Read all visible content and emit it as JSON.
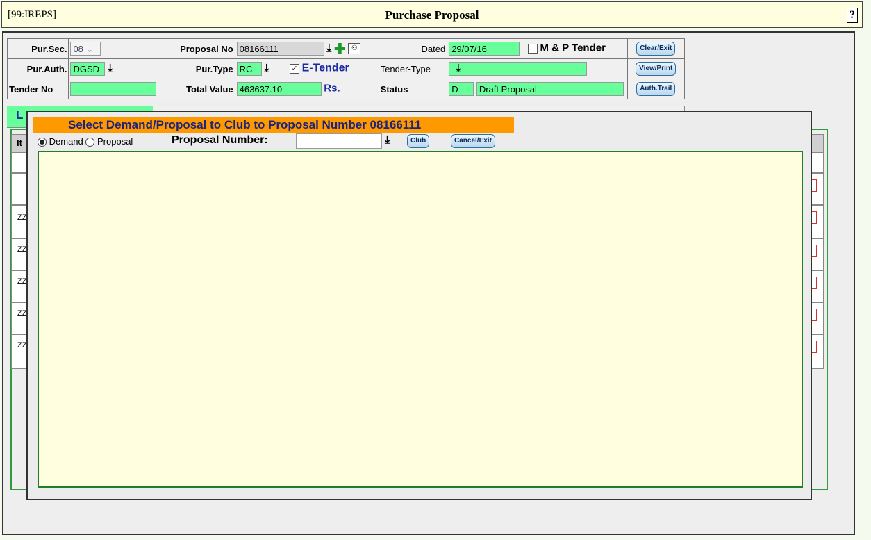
{
  "title_bar": {
    "system_id": "[99:IREPS]",
    "title": "Purchase Proposal",
    "help": "?"
  },
  "header": {
    "pur_sec": {
      "label": "Pur.Sec.",
      "value": "08"
    },
    "proposal_no": {
      "label": "Proposal No",
      "value": "08166111"
    },
    "dated": {
      "label": "Dated",
      "value": "29/07/16"
    },
    "mp_tender": {
      "label": "M & P Tender",
      "checked": false
    },
    "clear_exit": "Clear/Exit",
    "pur_auth": {
      "label": "Pur.Auth.",
      "value": "DGSD"
    },
    "pur_type": {
      "label": "Pur.Type",
      "value": "RC"
    },
    "e_tender": {
      "label": "E-Tender",
      "checked": true
    },
    "tender_type": {
      "label": "Tender-Type",
      "value": ""
    },
    "view_print": "View/Print",
    "tender_no": {
      "label": "Tender No",
      "value": ""
    },
    "total_value": {
      "label": "Total Value",
      "value": "463637.10",
      "unit": "Rs."
    },
    "status": {
      "label": "Status",
      "code": "D",
      "text": "Draft Proposal"
    },
    "auth_trail": "Auth.Trail"
  },
  "background_rows": {
    "partial_label_top": "L",
    "partial_label_col": "It",
    "row_codes": [
      "ZZ",
      "ZZ",
      "ZZ",
      "ZZ",
      "ZZ"
    ]
  },
  "modal": {
    "title": "Select Demand/Proposal to Club to Proposal Number 08166111",
    "radio_demand": "Demand",
    "radio_proposal": "Proposal",
    "selected": "Demand",
    "proposal_number_label": "Proposal Number:",
    "proposal_number_value": "",
    "club_button": "Club",
    "cancel_button": "Cancel/Exit"
  },
  "colors": {
    "field_green": "#66ff99",
    "title_orange": "#ff9900",
    "panel_yellow": "#ffffe0",
    "border_green": "#1e7e2a"
  }
}
